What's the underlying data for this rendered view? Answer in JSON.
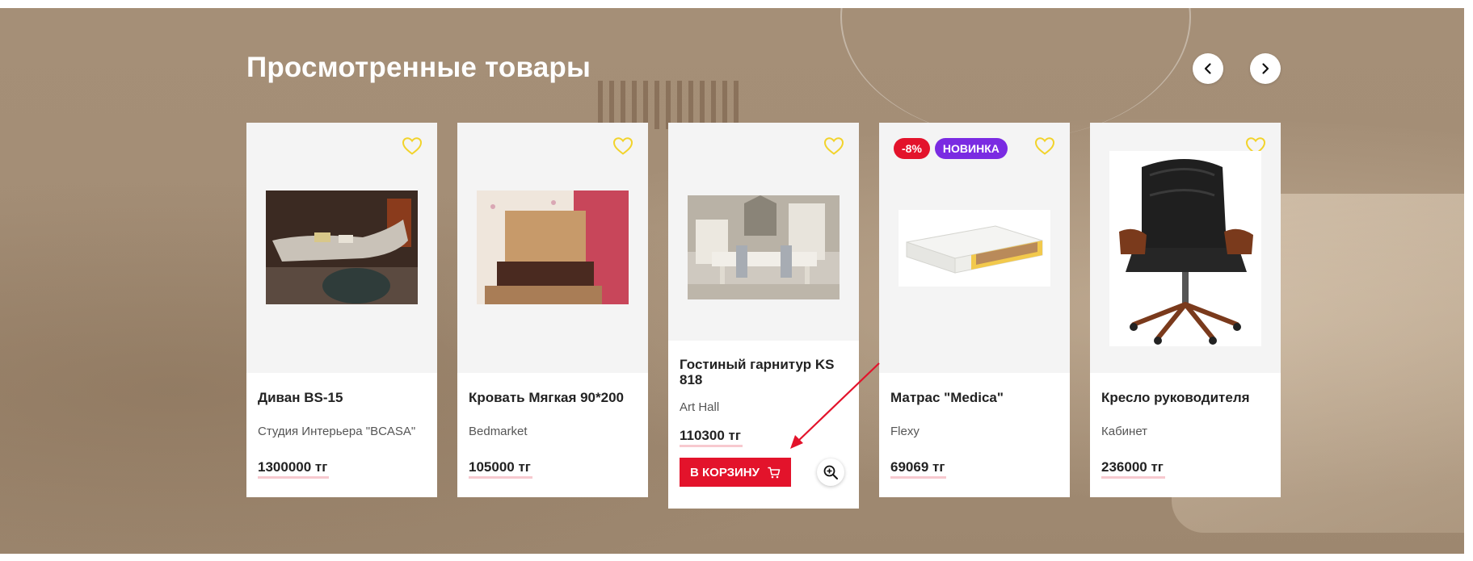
{
  "section": {
    "title": "Просмотренные товары",
    "prev_icon": "chevron-left-icon",
    "next_icon": "chevron-right-icon"
  },
  "colors": {
    "accent": "#e3132b",
    "badge_new": "#7a2be2",
    "heart": "#f2d32b",
    "price_underline": "#f7c9cf"
  },
  "products": [
    {
      "name": "Диван BS-15",
      "brand": "Студия Интерьера \"BCASA\"",
      "price": "1300000 тг",
      "favorite_icon": "heart-outline-icon",
      "image": "sofa-photo"
    },
    {
      "name": "Кровать Мягкая 90*200",
      "brand": "Bedmarket",
      "price": "105000 тг",
      "favorite_icon": "heart-outline-icon",
      "image": "bed-photo"
    },
    {
      "name": "Гостиный гарнитур KS 818",
      "brand": "Art Hall",
      "price": "110300 тг",
      "favorite_icon": "heart-outline-icon",
      "image": "living-room-set-photo",
      "cart_label": "В КОРЗИНУ",
      "cart_icon": "cart-icon",
      "zoom_icon": "zoom-in-icon"
    },
    {
      "name": "Матрас \"Medica\"",
      "brand": "Flexy",
      "price": "69069 тг",
      "favorite_icon": "heart-outline-icon",
      "image": "mattress-photo",
      "badges": [
        "-8%",
        "НОВИНКА"
      ]
    },
    {
      "name": "Кресло руководителя",
      "brand": "Кабинет",
      "price": "236000 тг",
      "favorite_icon": "heart-outline-icon",
      "image": "office-chair-photo"
    }
  ],
  "annotation": {
    "icon": "red-arrow-annotation",
    "color": "#e3132b"
  }
}
